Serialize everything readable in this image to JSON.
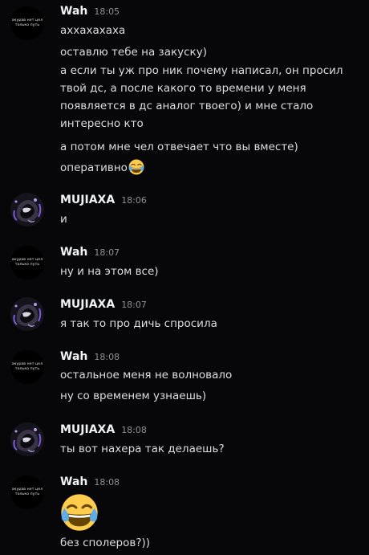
{
  "users": {
    "wah": {
      "name": "Wah",
      "avatar_text": [
        "акурав нет цел",
        "только путь"
      ]
    },
    "mujiaxa": {
      "name": "MUJIAXA"
    }
  },
  "groups": [
    {
      "author": "Wah",
      "time": "18:05",
      "messages": [
        "аххахахаха",
        "оставлю тебе на закуску)",
        "а если ты уж про ник почему написал, он просил твой дс, а после какого то времени у меня появляется в дс аналог твоего) и мне стало интересно кто",
        "а потом мне чел отвечает что вы вместе)",
        "оперативно"
      ]
    },
    {
      "author": "MUJIAXA",
      "time": "18:06",
      "messages": [
        "и"
      ]
    },
    {
      "author": "Wah",
      "time": "18:07",
      "messages": [
        "ну и на этом все)"
      ]
    },
    {
      "author": "MUJIAXA",
      "time": "18:07",
      "messages": [
        "я так то про дичь спросила"
      ]
    },
    {
      "author": "Wah",
      "time": "18:08",
      "messages": [
        "остальное меня не волновало",
        "ну со временем узнаешь)"
      ]
    },
    {
      "author": "MUJIAXA",
      "time": "18:08",
      "messages": [
        "ты вот нахера так делаешь?"
      ]
    },
    {
      "author": "Wah",
      "time": "18:08",
      "messages": [
        "без сполеров?))"
      ]
    }
  ],
  "emojis": {
    "inline": "joy-emoji",
    "big": "joy-emoji"
  },
  "colors": {
    "background": "#070709",
    "username": "#f2f3f5",
    "timestamp": "#8e9097",
    "text": "#dcdde1"
  }
}
